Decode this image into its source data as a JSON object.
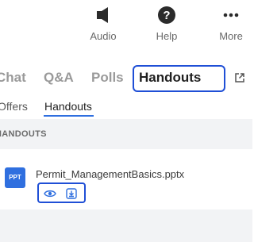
{
  "toolbar": {
    "items": [
      {
        "label": "Audio",
        "icon": "speaker-icon"
      },
      {
        "label": "Help",
        "icon": "help-circle-icon"
      },
      {
        "label": "More",
        "icon": "more-dots-icon"
      }
    ]
  },
  "tabs": {
    "items": [
      {
        "label": "Chat"
      },
      {
        "label": "Q&A"
      },
      {
        "label": "Polls"
      },
      {
        "label": "Handouts",
        "active": true
      }
    ],
    "popout_icon": "popout-icon"
  },
  "subtabs": {
    "items": [
      {
        "label": "Offers"
      },
      {
        "label": "Handouts",
        "active": true
      }
    ]
  },
  "section": {
    "title": "HANDOUTS"
  },
  "file": {
    "badge": "PPT",
    "name": "Permit_ManagementBasics.pptx",
    "actions": [
      {
        "icon": "view-eye-icon"
      },
      {
        "icon": "download-icon"
      }
    ]
  },
  "colors": {
    "accent": "#2f6fdf",
    "highlight": "#1f4fd6",
    "section_bg": "#f2f3f5"
  }
}
